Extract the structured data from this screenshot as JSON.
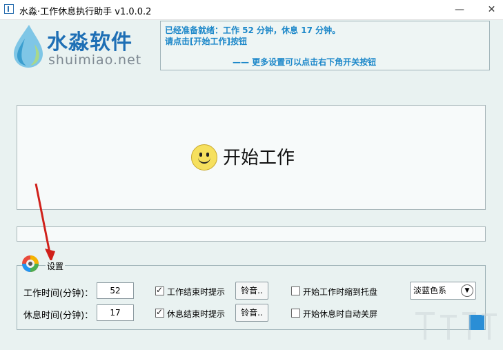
{
  "window": {
    "title": "水淼·工作休息执行助手 v1.0.0.2",
    "minimize": "—",
    "maximize": "□",
    "close": "✕"
  },
  "logo": {
    "main": "水淼软件",
    "sub": "shuimiao.net"
  },
  "info": {
    "line1": "已经准备就绪：工作 52 分钟，休息 17 分钟。",
    "line2": "请点击[开始工作]按钮",
    "line3": "—— 更多设置可以点击右下角开关按钮"
  },
  "start": {
    "label": "开始工作",
    "icon": "smiley-icon"
  },
  "settings": {
    "legend": "设置",
    "work_time_label": "工作时间(分钟)：",
    "work_time_value": "52",
    "rest_time_label": "休息时间(分钟)：",
    "rest_time_value": "17",
    "work_end_prompt_label": "工作结束时提示",
    "work_end_prompt_checked": true,
    "rest_end_prompt_label": "休息结束时提示",
    "rest_end_prompt_checked": true,
    "ring_button_1": "铃音..",
    "ring_button_2": "铃音..",
    "tray_label": "开始工作时缩到托盘",
    "tray_checked": false,
    "screen_off_label": "开始休息时自动关屏",
    "screen_off_checked": false,
    "theme_selected": "淡蓝色系"
  },
  "colors": {
    "background": "#e9f2f1",
    "accent_text": "#1b87c9",
    "logo_blue": "#1e6fb5",
    "arrow_red": "#d0201a"
  }
}
